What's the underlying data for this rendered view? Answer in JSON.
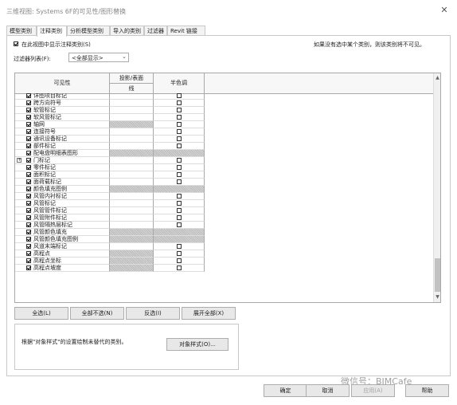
{
  "window": {
    "title": "三维视图: Systems 6F的可见性/图形替换"
  },
  "tabs": [
    "模型类别",
    "注释类别",
    "分析模型类别",
    "导入的类别",
    "过滤器",
    "Revit 链接"
  ],
  "active_tab": "注释类别",
  "show_annotations": {
    "label": "在此视图中显示注释类别(S)",
    "checked": true
  },
  "hint": "如果没有选中某个类别，则该类别将不可见。",
  "filter": {
    "label": "过滤器列表(F):",
    "value": "<全部显示>"
  },
  "grid": {
    "headers": {
      "visibility": "可见性",
      "projection": "投影/表面",
      "projection_sub": "线",
      "halftone": "半色调"
    },
    "rows": [
      {
        "label": "详图项目标记",
        "visible": true,
        "proj_hatched": false,
        "halftone_cb": true,
        "full_hatch": false,
        "expander": false
      },
      {
        "label": "跨方向符号",
        "visible": true,
        "proj_hatched": false,
        "halftone_cb": true,
        "full_hatch": false,
        "expander": false
      },
      {
        "label": "软管标记",
        "visible": true,
        "proj_hatched": false,
        "halftone_cb": true,
        "full_hatch": false,
        "expander": false
      },
      {
        "label": "软风管标记",
        "visible": true,
        "proj_hatched": false,
        "halftone_cb": true,
        "full_hatch": false,
        "expander": false
      },
      {
        "label": "轴网",
        "visible": true,
        "proj_hatched": true,
        "halftone_cb": true,
        "full_hatch": false,
        "expander": false
      },
      {
        "label": "连接符号",
        "visible": true,
        "proj_hatched": false,
        "halftone_cb": true,
        "full_hatch": false,
        "expander": false
      },
      {
        "label": "通讯设备标记",
        "visible": true,
        "proj_hatched": false,
        "halftone_cb": true,
        "full_hatch": false,
        "expander": false
      },
      {
        "label": "部件标记",
        "visible": true,
        "proj_hatched": false,
        "halftone_cb": true,
        "full_hatch": false,
        "expander": false
      },
      {
        "label": "配电盘明细表图形",
        "visible": true,
        "proj_hatched": true,
        "halftone_cb": false,
        "full_hatch": true,
        "expander": false
      },
      {
        "label": "门标记",
        "visible": true,
        "proj_hatched": false,
        "halftone_cb": true,
        "full_hatch": false,
        "expander": true
      },
      {
        "label": "零件标记",
        "visible": true,
        "proj_hatched": false,
        "halftone_cb": true,
        "full_hatch": false,
        "expander": false
      },
      {
        "label": "面积标记",
        "visible": true,
        "proj_hatched": false,
        "halftone_cb": true,
        "full_hatch": false,
        "expander": false
      },
      {
        "label": "面荷载标记",
        "visible": true,
        "proj_hatched": false,
        "halftone_cb": true,
        "full_hatch": false,
        "expander": false
      },
      {
        "label": "颜色填充图例",
        "visible": true,
        "proj_hatched": true,
        "halftone_cb": false,
        "full_hatch": true,
        "expander": false
      },
      {
        "label": "风管内衬标记",
        "visible": true,
        "proj_hatched": false,
        "halftone_cb": true,
        "full_hatch": false,
        "expander": false
      },
      {
        "label": "风管标记",
        "visible": true,
        "proj_hatched": false,
        "halftone_cb": true,
        "full_hatch": false,
        "expander": false
      },
      {
        "label": "风管管件标记",
        "visible": true,
        "proj_hatched": false,
        "halftone_cb": true,
        "full_hatch": false,
        "expander": false
      },
      {
        "label": "风管附件标记",
        "visible": true,
        "proj_hatched": false,
        "halftone_cb": true,
        "full_hatch": false,
        "expander": false
      },
      {
        "label": "风管隔热层标记",
        "visible": true,
        "proj_hatched": false,
        "halftone_cb": true,
        "full_hatch": false,
        "expander": false
      },
      {
        "label": "风管颜色填充",
        "visible": true,
        "proj_hatched": true,
        "halftone_cb": false,
        "full_hatch": true,
        "expander": false
      },
      {
        "label": "风管颜色填充图例",
        "visible": true,
        "proj_hatched": true,
        "halftone_cb": false,
        "full_hatch": true,
        "expander": false
      },
      {
        "label": "风道末端标记",
        "visible": true,
        "proj_hatched": false,
        "halftone_cb": true,
        "full_hatch": false,
        "expander": false
      },
      {
        "label": "高程点",
        "visible": true,
        "proj_hatched": true,
        "halftone_cb": true,
        "full_hatch": false,
        "expander": false
      },
      {
        "label": "高程点坐标",
        "visible": true,
        "proj_hatched": true,
        "halftone_cb": true,
        "full_hatch": false,
        "expander": false
      },
      {
        "label": "高程点坡度",
        "visible": true,
        "proj_hatched": true,
        "halftone_cb": true,
        "full_hatch": false,
        "expander": false
      }
    ]
  },
  "buttons": {
    "select_all": "全选(L)",
    "select_none": "全部不选(N)",
    "invert": "反选(I)",
    "expand_all": "展开全部(X)",
    "object_styles": "对象样式(O)...",
    "ok": "确定",
    "cancel": "取消",
    "apply": "应用(A)",
    "help": "帮助"
  },
  "bottom_note": "根据\"对象样式\"的设置绘制未替代的类别。",
  "watermark": "微信号：BIMCafe",
  "icons": {
    "close": "close-icon",
    "chevron": "chevron-down-icon",
    "scroll_up": "arrow-up-icon",
    "scroll_down": "arrow-down-icon",
    "expander": "plus-icon"
  }
}
